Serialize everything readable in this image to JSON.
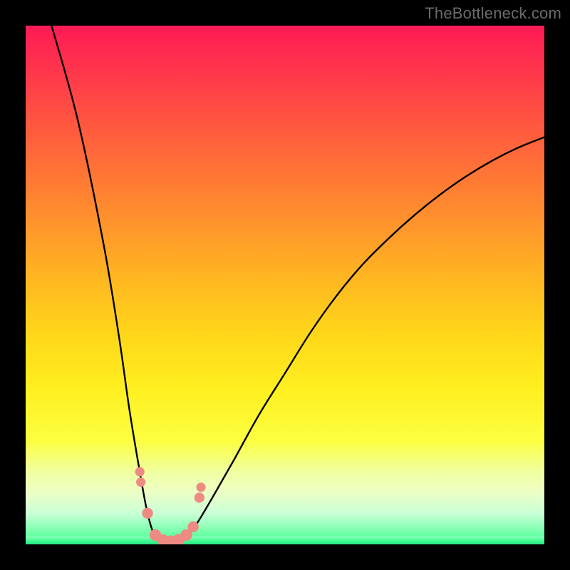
{
  "watermark": "TheBottleneck.com",
  "chart_data": {
    "type": "line",
    "title": "",
    "xlabel": "",
    "ylabel": "",
    "xlim": [
      0,
      100
    ],
    "ylim": [
      0,
      100
    ],
    "grid": false,
    "series": [
      {
        "name": "curve",
        "x": [
          5,
          10,
          15,
          18,
          20,
          22,
          23.5,
          25,
          27,
          29,
          31,
          33,
          36,
          40,
          45,
          50,
          55,
          60,
          65,
          70,
          75,
          80,
          85,
          90,
          95,
          100
        ],
        "values": [
          100,
          82,
          58,
          40,
          26,
          14,
          6,
          1.5,
          0.5,
          0.5,
          1.5,
          4,
          9,
          16,
          25,
          33,
          41,
          48,
          54,
          59,
          63.5,
          67.5,
          71,
          74,
          76.5,
          78.5
        ]
      }
    ],
    "markers": {
      "name": "highlight-cluster",
      "color": "#ed8a82",
      "points": [
        {
          "x": 22.0,
          "y": 14.0,
          "r": 1.2
        },
        {
          "x": 22.2,
          "y": 12.0,
          "r": 1.2
        },
        {
          "x": 23.5,
          "y": 6.0,
          "r": 1.4
        },
        {
          "x": 25.0,
          "y": 1.8,
          "r": 1.5
        },
        {
          "x": 26.5,
          "y": 0.8,
          "r": 1.5
        },
        {
          "x": 28.0,
          "y": 0.6,
          "r": 1.5
        },
        {
          "x": 29.5,
          "y": 0.9,
          "r": 1.5
        },
        {
          "x": 31.0,
          "y": 1.8,
          "r": 1.5
        },
        {
          "x": 32.3,
          "y": 3.4,
          "r": 1.4
        },
        {
          "x": 33.5,
          "y": 9.0,
          "r": 1.3
        },
        {
          "x": 33.8,
          "y": 11.0,
          "r": 1.2
        }
      ]
    },
    "colors": {
      "curve": "#000000",
      "marker": "#ed8a82",
      "gradient_top": "#ff1a55",
      "gradient_mid": "#ffef20",
      "gradient_bottom": "#22e884"
    }
  }
}
